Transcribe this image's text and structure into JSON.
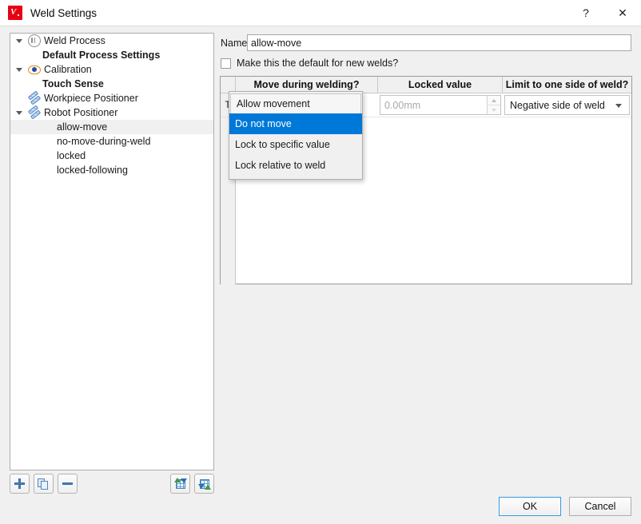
{
  "window": {
    "title": "Weld Settings",
    "app_icon": "weld-app-icon",
    "help_label": "?",
    "close_label": "✕"
  },
  "tree": {
    "items": [
      {
        "label": "Weld Process",
        "icon": "weld-process-icon",
        "twisty": "expanded",
        "bold": false,
        "indent": "icon",
        "selected": false
      },
      {
        "label": "Default Process Settings",
        "icon": "none",
        "twisty": "none",
        "bold": true,
        "indent": "child",
        "selected": false
      },
      {
        "label": "Calibration",
        "icon": "eye-icon",
        "twisty": "expanded",
        "bold": false,
        "indent": "icon",
        "selected": false
      },
      {
        "label": "Touch Sense",
        "icon": "none",
        "twisty": "none",
        "bold": true,
        "indent": "child",
        "selected": false
      },
      {
        "label": "Workpiece Positioner",
        "icon": "positioner-icon",
        "twisty": "none",
        "bold": false,
        "indent": "icon",
        "selected": false
      },
      {
        "label": "Robot Positioner",
        "icon": "positioner-icon",
        "twisty": "expanded",
        "bold": false,
        "indent": "icon",
        "selected": false
      },
      {
        "label": "allow-move",
        "icon": "none",
        "twisty": "none",
        "bold": false,
        "indent": "leaf",
        "selected": true
      },
      {
        "label": "no-move-during-weld",
        "icon": "none",
        "twisty": "none",
        "bold": false,
        "indent": "leaf",
        "selected": false
      },
      {
        "label": "locked",
        "icon": "none",
        "twisty": "none",
        "bold": false,
        "indent": "leaf",
        "selected": false
      },
      {
        "label": "locked-following",
        "icon": "none",
        "twisty": "none",
        "bold": false,
        "indent": "leaf",
        "selected": false
      }
    ]
  },
  "tree_toolbar": {
    "add": "add-icon",
    "duplicate": "duplicate-icon",
    "remove": "remove-icon",
    "import": "import-table-icon",
    "export": "export-table-icon"
  },
  "form": {
    "name_label": "Name",
    "name_value": "allow-move",
    "name_placeholder": "",
    "default_checkbox_label": "Make this the default for new welds?",
    "default_checkbox_checked": false
  },
  "table": {
    "row_header_corner": "",
    "headers": [
      "Move during welding?",
      "Locked value",
      "Limit to one side of weld?"
    ],
    "rows": [
      {
        "row_header": "T",
        "move_during_welding": "Allow movement",
        "locked_value": "0.00mm",
        "locked_value_disabled": true,
        "limit_to_one_side": "Negative side of weld"
      }
    ]
  },
  "combo_popup": {
    "open_for_column": "Move during welding?",
    "editor_value": "Allow movement",
    "options": [
      {
        "label": "Allow movement",
        "selected": false
      },
      {
        "label": "Do not move",
        "selected": true
      },
      {
        "label": "Lock to specific value",
        "selected": false
      },
      {
        "label": "Lock relative to weld",
        "selected": false
      }
    ]
  },
  "dialog_buttons": {
    "ok": "OK",
    "cancel": "Cancel"
  },
  "colors": {
    "highlight": "#0078d7",
    "app_icon": "#e60012",
    "window_bg": "#f0f0f0",
    "focus_border": "#2f9ae0"
  }
}
